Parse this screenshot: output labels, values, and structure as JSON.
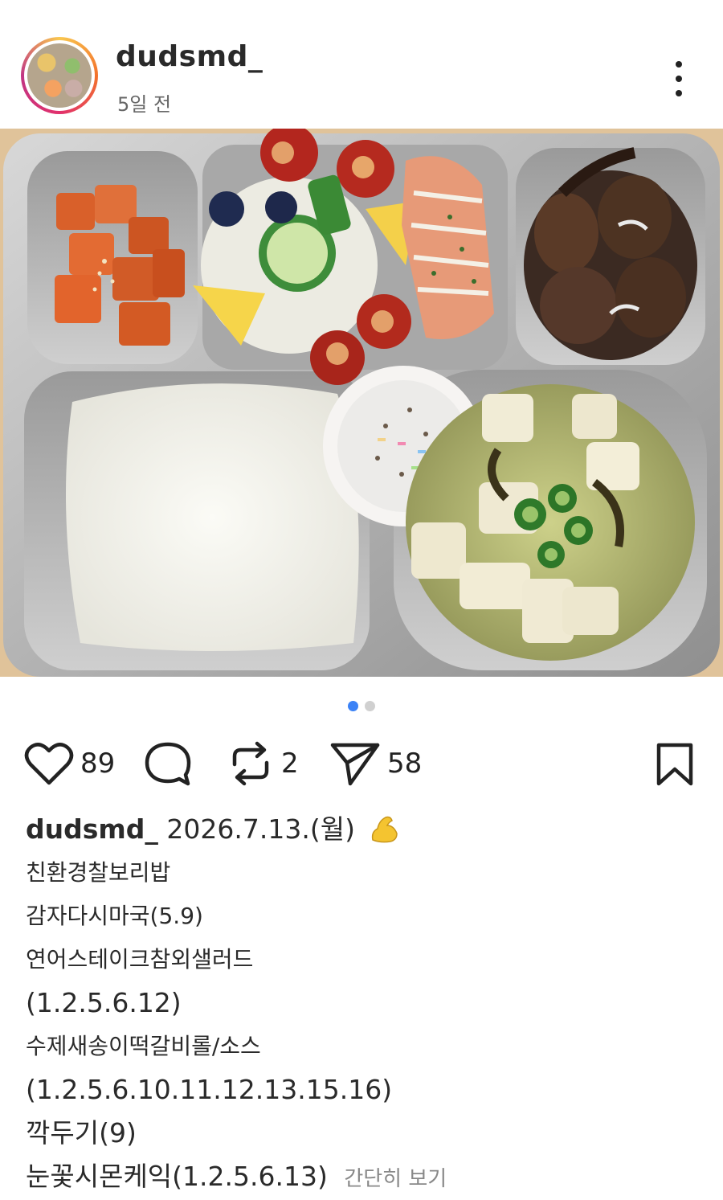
{
  "post": {
    "username": "dudsmd_",
    "time_ago": "5일 전",
    "likes": "89",
    "reposts": "2",
    "shares": "58",
    "carousel": {
      "count": 2,
      "active_index": 0
    }
  },
  "caption": {
    "username": "dudsmd_",
    "date": "2026.7.13.(월)",
    "emoji": "flexed-biceps",
    "lines": [
      "친환경찰보리밥",
      "감자다시마국(5.9)",
      "연어스테이크참외샐러드",
      "(1.2.5.6.12)",
      "수제새송이떡갈비롤/소스",
      "(1.2.5.6.10.11.12.13.15.16)",
      "깍두기(9)",
      "눈꽃시몬케익(1.2.5.6.13)"
    ],
    "more_label": "간단히 보기"
  },
  "colors": {
    "accent_dot": "#3b82f6",
    "text": "#2a2a2a",
    "muted": "#888888"
  }
}
